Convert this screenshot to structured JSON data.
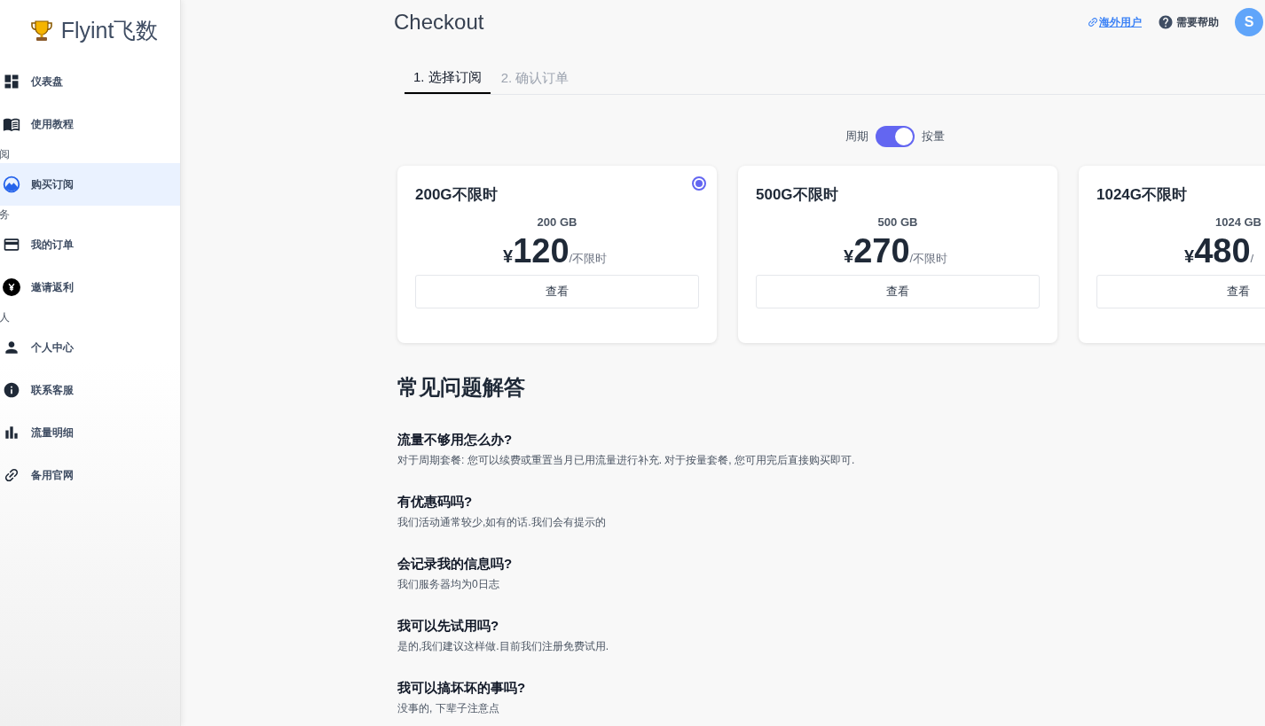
{
  "sidebar": {
    "logo": "Flyint飞数",
    "groups": [
      {
        "items": [
          {
            "label": "仪表盘",
            "selected": false
          },
          {
            "label": "使用教程",
            "selected": false
          }
        ]
      },
      {
        "header": "阅",
        "items": [
          {
            "label": "购买订阅",
            "selected": true
          }
        ]
      },
      {
        "header": "务",
        "items": [
          {
            "label": "我的订单",
            "selected": false
          },
          {
            "label": "邀请返利",
            "selected": false
          }
        ]
      },
      {
        "header": "人",
        "items": [
          {
            "label": "个人中心",
            "selected": false
          },
          {
            "label": "联系客服",
            "selected": false
          },
          {
            "label": "流量明细",
            "selected": false
          },
          {
            "label": "备用官网",
            "selected": false
          }
        ]
      }
    ]
  },
  "header": {
    "title": "Checkout",
    "overseas_link": "海外用户",
    "help": "需要帮助",
    "avatar": "S"
  },
  "steps": [
    {
      "label": "1. 选择订阅",
      "selected": true
    },
    {
      "label": "2. 确认订单",
      "selected": false
    }
  ],
  "billing_toggle": {
    "left_label": "周期",
    "right_label": "按量",
    "on": true
  },
  "plans": [
    {
      "name": "200G不限时",
      "traffic": "200 GB",
      "currency": "¥",
      "price": "120",
      "unit": "/不限时",
      "button": "查看",
      "selected": true
    },
    {
      "name": "500G不限时",
      "traffic": "500 GB",
      "currency": "¥",
      "price": "270",
      "unit": "/不限时",
      "button": "查看",
      "selected": false
    },
    {
      "name": "1024G不限时",
      "traffic": "1024 GB",
      "currency": "¥",
      "price": "480",
      "unit": "/",
      "button": "查看",
      "selected": false
    }
  ],
  "faq": {
    "title": "常见问题解答",
    "items": [
      {
        "question": "流量不够用怎么办?",
        "answer": "对于周期套餐: 您可以续费或重置当月已用流量进行补充. 对于按量套餐, 您可用完后直接购买即可."
      },
      {
        "question": "有优惠码吗?",
        "answer": "我们活动通常较少,如有的话.我们会有提示的"
      },
      {
        "question": "会记录我的信息吗?",
        "answer": "我们服务器均为0日志"
      },
      {
        "question": "我可以先试用吗?",
        "answer": "是的,我们建议这样做.目前我们注册免费试用."
      },
      {
        "question": "我可以搞坏坏的事吗?",
        "answer": "没事的, 下辈子注意点"
      }
    ]
  }
}
